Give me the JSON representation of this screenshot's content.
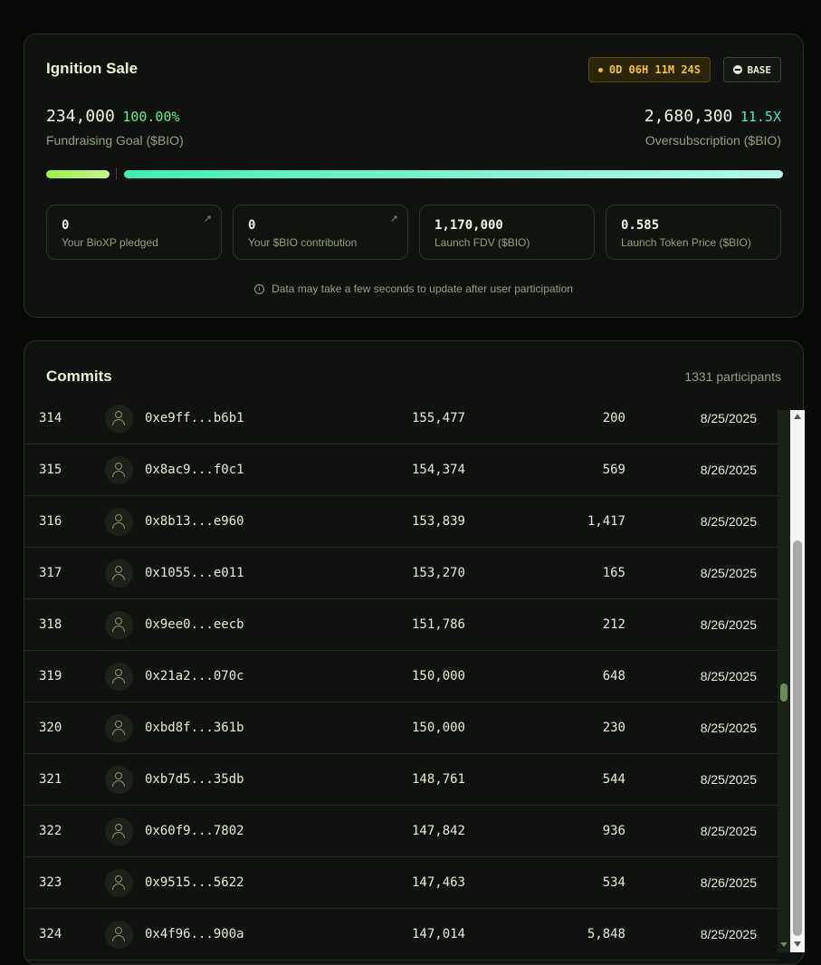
{
  "sale": {
    "title": "Ignition Sale",
    "timer": "0D 06H 11M 24S",
    "chain": "BASE",
    "goal_value": "234,000",
    "goal_pct": "100.00%",
    "goal_label": "Fundraising Goal ($BIO)",
    "over_value": "2,680,300",
    "over_mult": "11.5X",
    "over_label": "Oversubscription ($BIO)",
    "stats": [
      {
        "value": "0",
        "label": "Your BioXP pledged"
      },
      {
        "value": "0",
        "label": "Your $BIO contribution"
      },
      {
        "value": "1,170,000",
        "label": "Launch FDV ($BIO)"
      },
      {
        "value": "0.585",
        "label": "Launch Token Price ($BIO)"
      }
    ],
    "note": "Data may take a few seconds to update after user participation"
  },
  "commits": {
    "title": "Commits",
    "participants": "1331 participants",
    "rows": [
      {
        "rank": "314",
        "address": "0xe9ff...b6b1",
        "amount": "155,477",
        "bioxp": "200",
        "date": "8/25/2025"
      },
      {
        "rank": "315",
        "address": "0x8ac9...f0c1",
        "amount": "154,374",
        "bioxp": "569",
        "date": "8/26/2025"
      },
      {
        "rank": "316",
        "address": "0x8b13...e960",
        "amount": "153,839",
        "bioxp": "1,417",
        "date": "8/25/2025"
      },
      {
        "rank": "317",
        "address": "0x1055...e011",
        "amount": "153,270",
        "bioxp": "165",
        "date": "8/25/2025"
      },
      {
        "rank": "318",
        "address": "0x9ee0...eecb",
        "amount": "151,786",
        "bioxp": "212",
        "date": "8/26/2025"
      },
      {
        "rank": "319",
        "address": "0x21a2...070c",
        "amount": "150,000",
        "bioxp": "648",
        "date": "8/25/2025"
      },
      {
        "rank": "320",
        "address": "0xbd8f...361b",
        "amount": "150,000",
        "bioxp": "230",
        "date": "8/25/2025"
      },
      {
        "rank": "321",
        "address": "0xb7d5...35db",
        "amount": "148,761",
        "bioxp": "544",
        "date": "8/25/2025"
      },
      {
        "rank": "322",
        "address": "0x60f9...7802",
        "amount": "147,842",
        "bioxp": "936",
        "date": "8/25/2025"
      },
      {
        "rank": "323",
        "address": "0x9515...5622",
        "amount": "147,463",
        "bioxp": "534",
        "date": "8/26/2025"
      },
      {
        "rank": "324",
        "address": "0x4f96...900a",
        "amount": "147,014",
        "bioxp": "5,848",
        "date": "8/25/2025"
      }
    ]
  }
}
